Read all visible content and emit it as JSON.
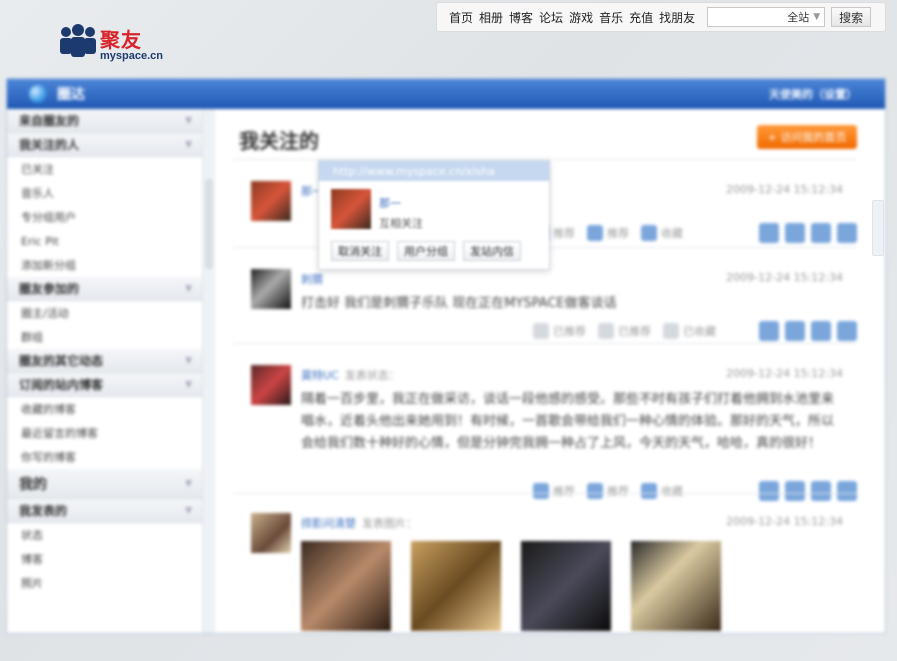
{
  "topnav": {
    "links": [
      "首页",
      "相册",
      "博客",
      "论坛",
      "游戏",
      "音乐",
      "充值",
      "找朋友"
    ],
    "scope": "全站",
    "search_label": "搜索"
  },
  "logo": {
    "brand_cn": "聚友",
    "brand_en": "myspace.cn"
  },
  "panel": {
    "title": "圈达",
    "user_info": "天使美的（设置）"
  },
  "sidebar": {
    "sections": [
      {
        "head": "来自圈友的",
        "big": false,
        "items": []
      },
      {
        "head": "我关注的人",
        "big": false,
        "items": [
          "已关注",
          "音乐人",
          "专分组用户",
          "Eric Pit",
          "添加新分组"
        ]
      },
      {
        "head": "圈友参加的",
        "big": false,
        "items": [
          "圈主/活动",
          "群组"
        ]
      },
      {
        "head": "圈友的其它动态",
        "big": false,
        "items": []
      },
      {
        "head": "订阅的站内博客",
        "big": false,
        "items": [
          "收藏的博客",
          "最近留言的博客",
          "你写的博客"
        ]
      },
      {
        "head": "我的",
        "big": true,
        "items": []
      },
      {
        "head": "我发表的",
        "big": false,
        "items": [
          "状态",
          "博客",
          "照片"
        ]
      }
    ]
  },
  "content": {
    "title": "我关注的",
    "orange_button": "+ 访问我的首页",
    "feeds": [
      {
        "name": "那一",
        "action": "",
        "time": "2009-12-24 15:12:34",
        "text": "",
        "actions": [
          "推荐",
          "推荐",
          "收藏"
        ]
      },
      {
        "name": "刺猬",
        "action": "",
        "time": "2009-12-24 15:12:34",
        "text": "打击好 我们是刺猬子乐队 现在正在MYSPACE做客谈话",
        "actions": [
          "已推荐",
          "已推荐",
          "已收藏"
        ]
      },
      {
        "name": "莫特UC",
        "action": "发表状态：",
        "time": "2009-12-24 15:12:34",
        "text": "隔着一百步里，我正在做采访，谈话一段他感的感受。那些不时有孩子们打着他拥到水池里来唱水，近着头他出来她用到！有时候，一首歌会带给我们一种心情的体验。那好的天气，所以会给我们数十种好的心情，但是分钟完我拥一种占了上风，今天的天气，哈哈，真的很好！",
        "actions": [
          "推荐",
          "推荐",
          "收藏"
        ]
      },
      {
        "name": "捞影问清楚",
        "action": "发表图片：",
        "time": "2009-12-24 15:12:34",
        "text": "",
        "actions": []
      }
    ]
  },
  "popup": {
    "url": "http://www.myspace.cn/xisha",
    "name": "那一",
    "status": "互相关注",
    "buttons": [
      "取消关注",
      "用户分组",
      "发站内信"
    ]
  }
}
